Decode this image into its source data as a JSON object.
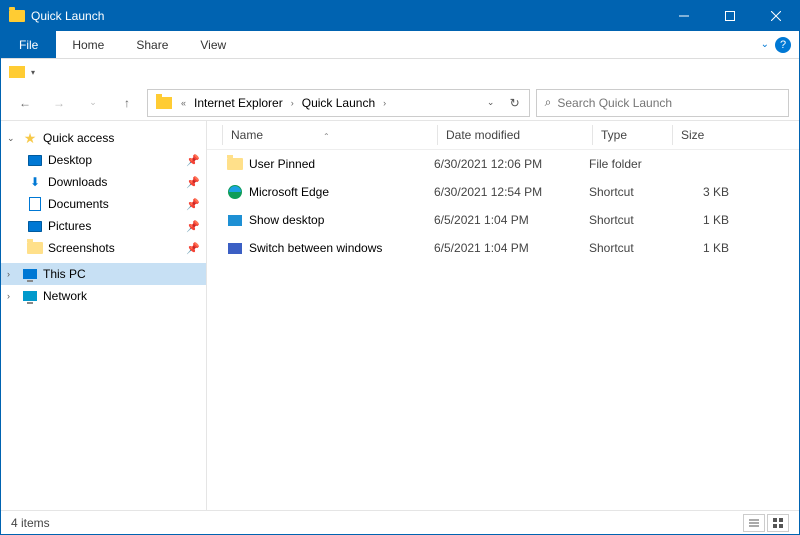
{
  "window": {
    "title": "Quick Launch"
  },
  "ribbon": {
    "file": "File",
    "home": "Home",
    "share": "Share",
    "view": "View"
  },
  "breadcrumb": {
    "segment1": "Internet Explorer",
    "segment2": "Quick Launch"
  },
  "search": {
    "placeholder": "Search Quick Launch"
  },
  "sidebar": {
    "quick_access": "Quick access",
    "items": [
      {
        "label": "Desktop"
      },
      {
        "label": "Downloads"
      },
      {
        "label": "Documents"
      },
      {
        "label": "Pictures"
      },
      {
        "label": "Screenshots"
      }
    ],
    "this_pc": "This PC",
    "network": "Network"
  },
  "columns": {
    "name": "Name",
    "date": "Date modified",
    "type": "Type",
    "size": "Size"
  },
  "rows": [
    {
      "name": "User Pinned",
      "date": "6/30/2021 12:06 PM",
      "type": "File folder",
      "size": ""
    },
    {
      "name": "Microsoft Edge",
      "date": "6/30/2021 12:54 PM",
      "type": "Shortcut",
      "size": "3 KB"
    },
    {
      "name": "Show desktop",
      "date": "6/5/2021 1:04 PM",
      "type": "Shortcut",
      "size": "1 KB"
    },
    {
      "name": "Switch between windows",
      "date": "6/5/2021 1:04 PM",
      "type": "Shortcut",
      "size": "1 KB"
    }
  ],
  "status": {
    "count": "4 items"
  }
}
